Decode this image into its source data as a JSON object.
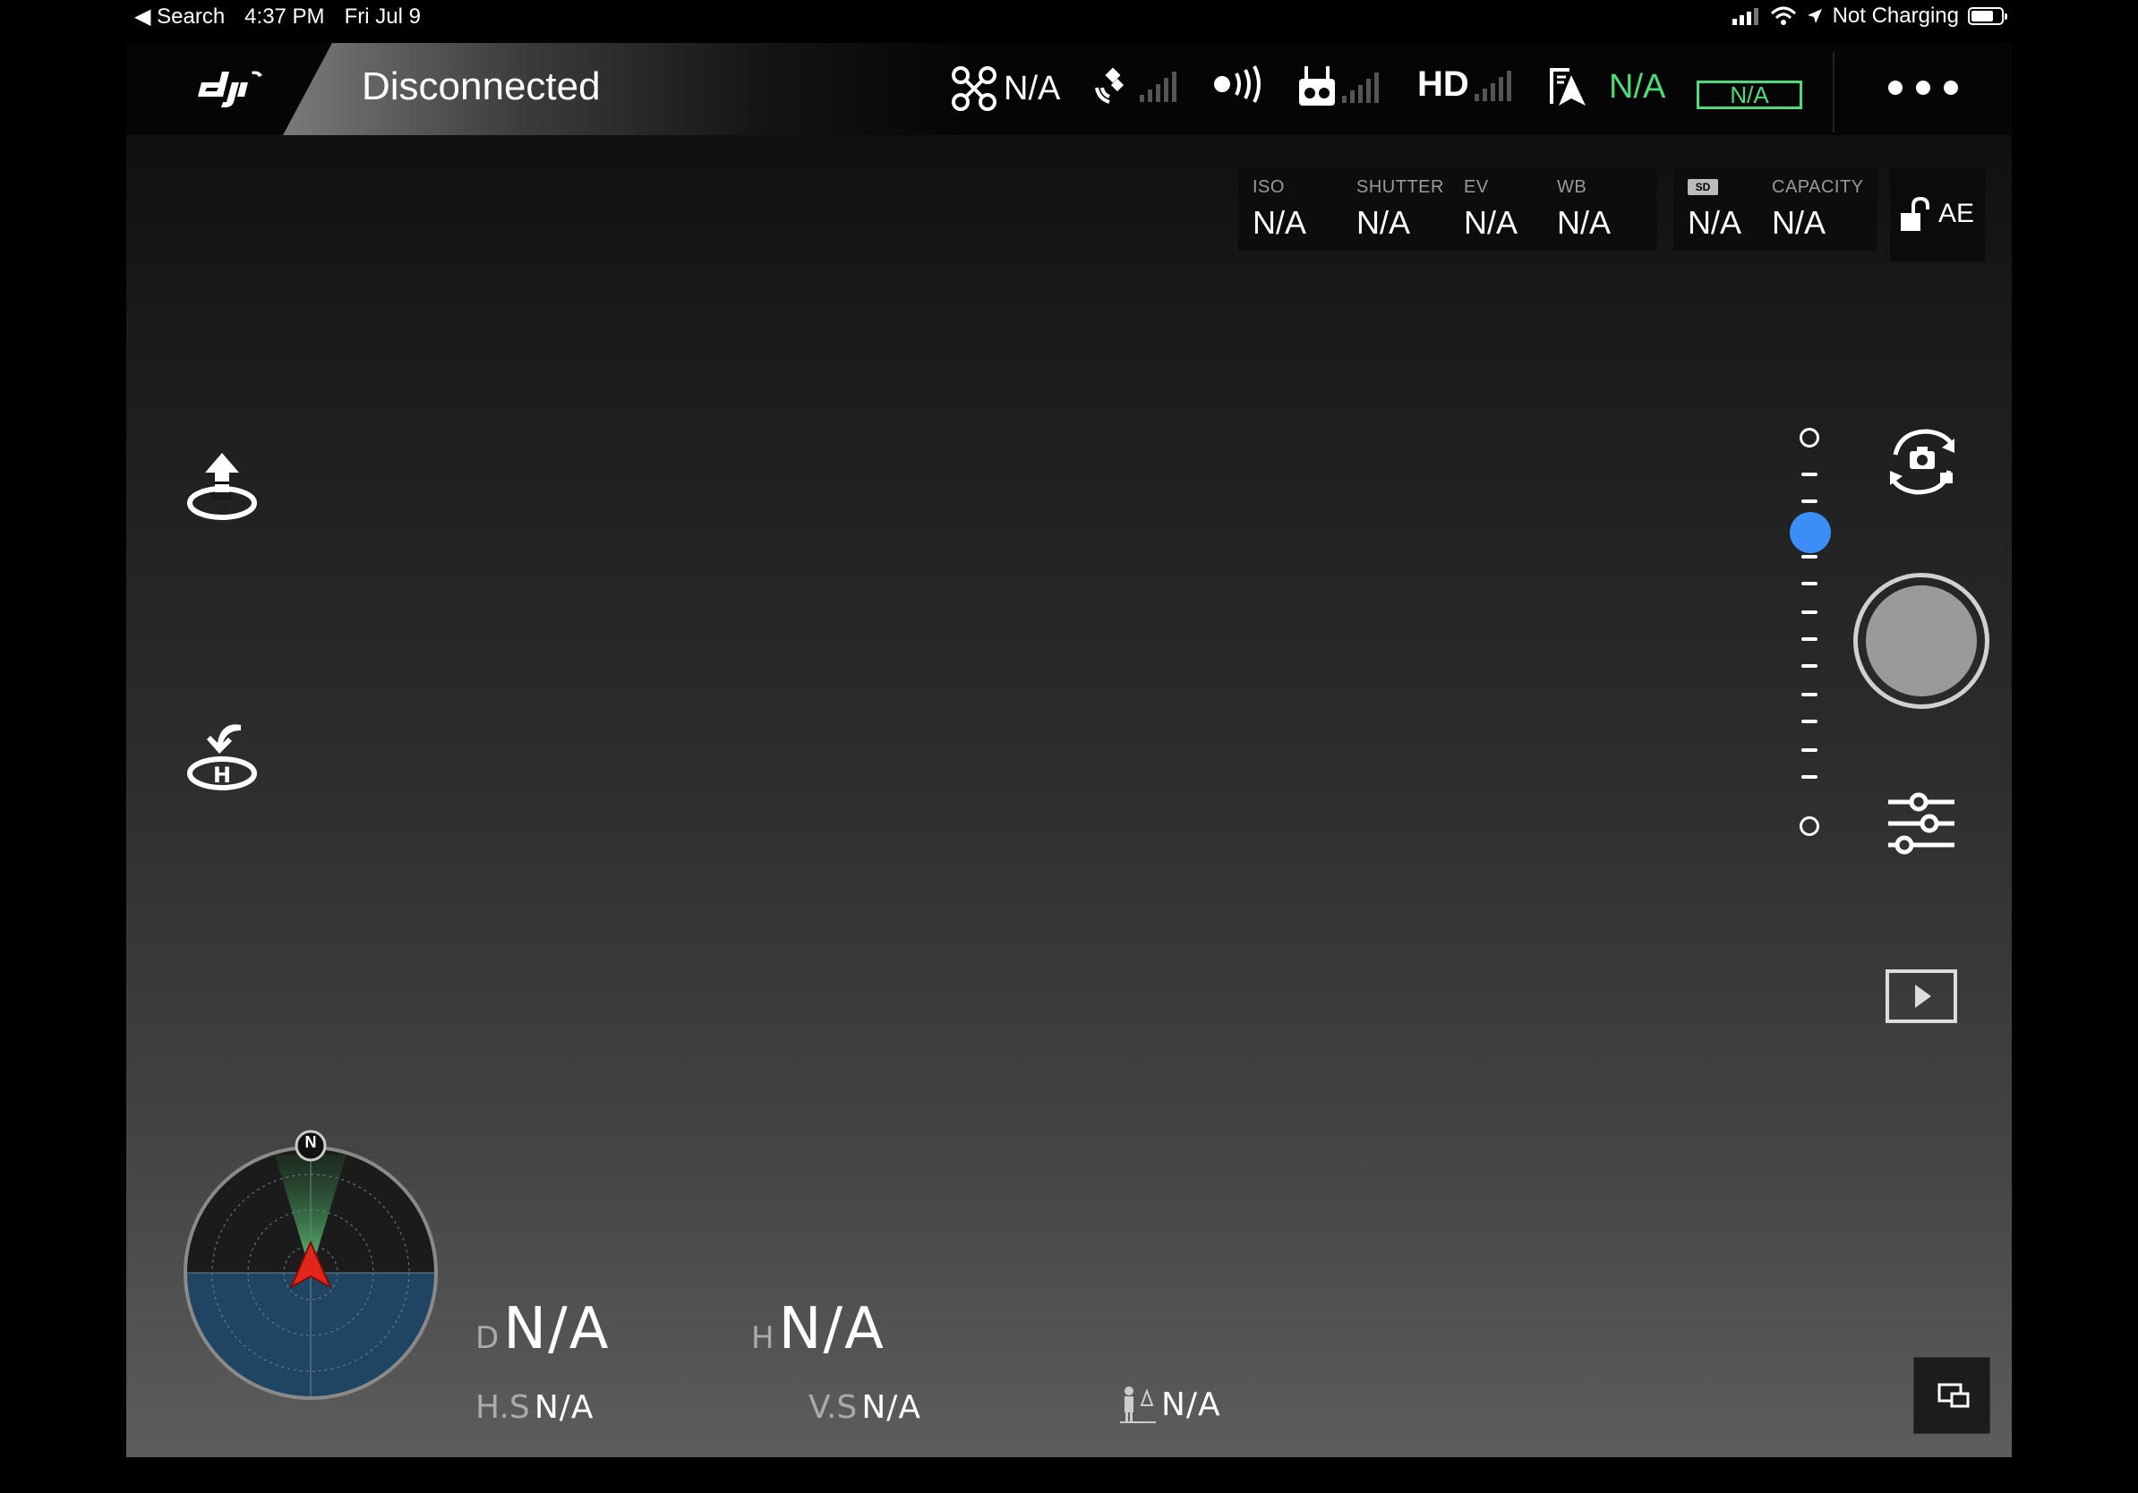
{
  "status_bar": {
    "back_label": "◀ Search",
    "time": "4:37 PM",
    "date": "Fri Jul 9",
    "charging": "Not Charging",
    "battery_level": 0.75
  },
  "topbar": {
    "connection_status": "Disconnected",
    "aircraft_value": "N/A",
    "battery_value": "N/A",
    "battery_voltage_box": "N/A",
    "hd_label": "HD"
  },
  "camera": {
    "iso_label": "ISO",
    "iso_value": "N/A",
    "shutter_label": "SHUTTER",
    "shutter_value": "N/A",
    "ev_label": "EV",
    "ev_value": "N/A",
    "wb_label": "WB",
    "wb_value": "N/A",
    "sd_label": "SD",
    "sd_value": "N/A",
    "capacity_label": "CAPACITY",
    "capacity_value": "N/A",
    "ae_label": "AE"
  },
  "zoom": {
    "level": 0.25
  },
  "compass": {
    "north_label": "N"
  },
  "telemetry": {
    "distance_label": "D",
    "distance_value": "N/A",
    "height_label": "H",
    "height_value": "N/A",
    "hspeed_label": "H.S",
    "hspeed_value": "N/A",
    "vspeed_label": "V.S",
    "vspeed_value": "N/A",
    "pilot_distance_value": "N/A"
  },
  "colors": {
    "accent_green": "#4ddb7a",
    "zoom_knob": "#3b8ef5",
    "compass_sky": "#1f4563",
    "aircraft_arrow": "#e2261c"
  }
}
